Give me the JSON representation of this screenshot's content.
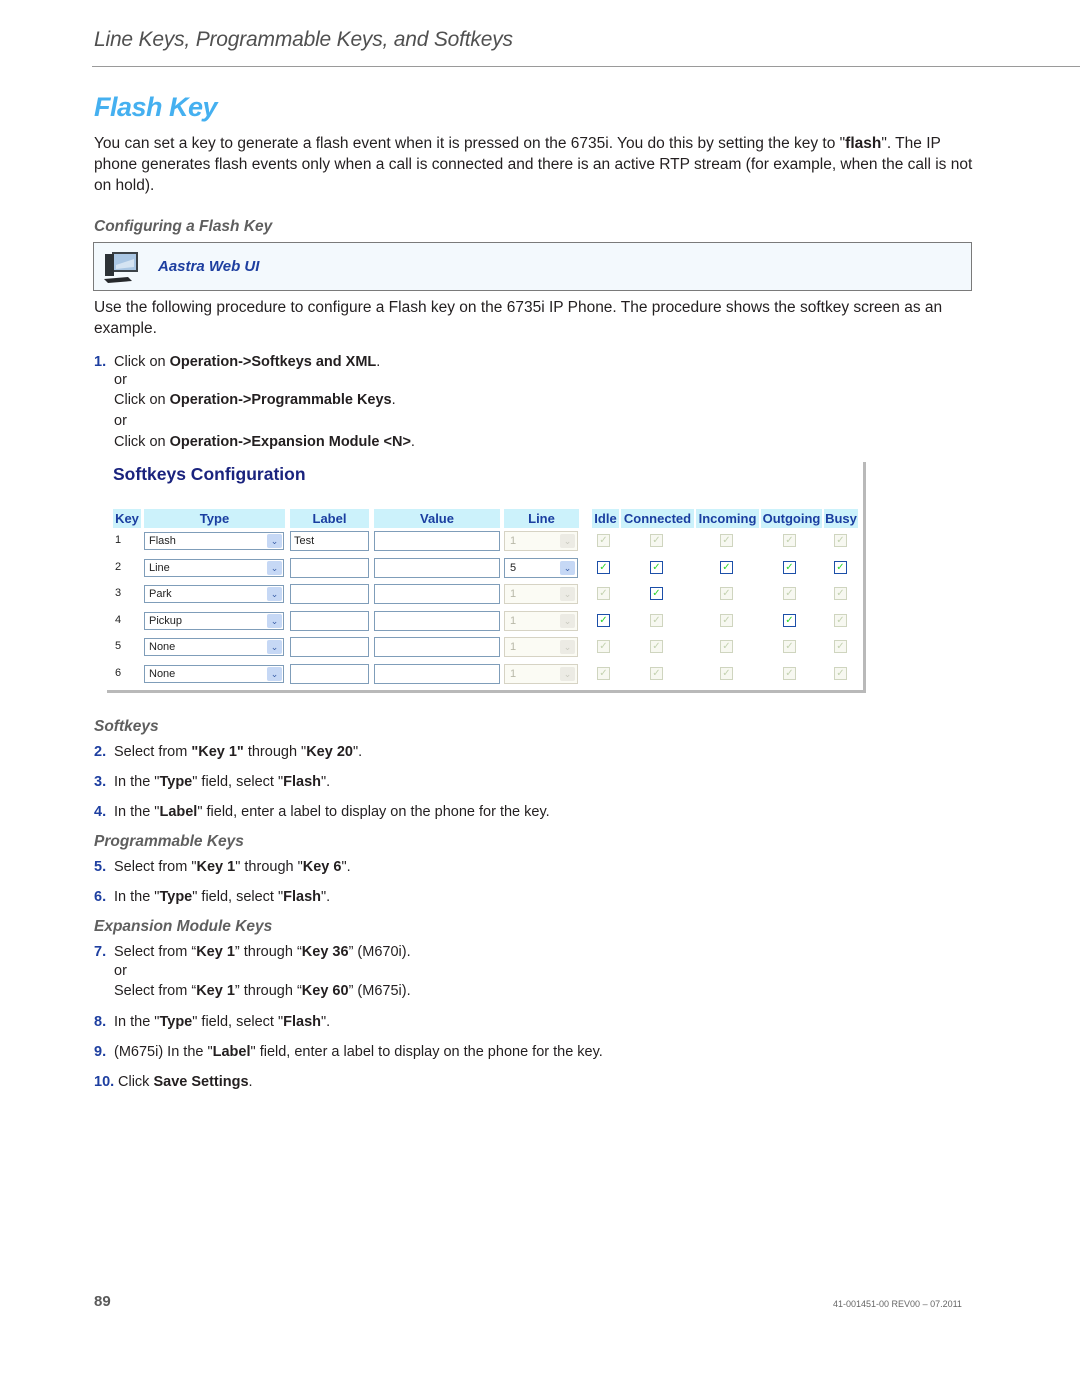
{
  "running_head": "Line Keys, Programmable Keys, and Softkeys",
  "title": "Flash Key",
  "intro": {
    "before": "You can set a key to generate a flash event when it is pressed on the 6735i. You do this by setting the key to \"",
    "bold": "flash",
    "after": "\". The IP phone generates flash events only when a call is connected and there is an active RTP stream (for example, when the call is not on hold)."
  },
  "section_heading": "Configuring a Flash Key",
  "web_ui_box": {
    "icon": "computer-icon",
    "label": "Aastra Web UI"
  },
  "procedure_intro": "Use the following procedure to configure a Flash key on the 6735i IP Phone. The procedure shows the softkey screen as an example.",
  "step1": {
    "num": "1.",
    "a_pre": "Click on ",
    "a_bold": "Operation->Softkeys and XML",
    "a_post": ".",
    "or1": "or",
    "b_pre": "Click on ",
    "b_bold": "Operation->Programmable Keys",
    "b_post": ".",
    "or2": "or",
    "c_pre": "Click on ",
    "c_bold": "Operation->Expansion Module <N>",
    "c_post": "."
  },
  "screenshot": {
    "title": "Softkeys Configuration",
    "columns": [
      "Key",
      "Type",
      "Label",
      "Value",
      "Line",
      "Idle",
      "Connected",
      "Incoming",
      "Outgoing",
      "Busy"
    ],
    "rows": [
      {
        "key": "1",
        "type": "Flash",
        "label": "Test",
        "value": "",
        "line": "1",
        "line_enabled": false,
        "states": [
          {
            "checked": true,
            "enabled": false
          },
          {
            "checked": true,
            "enabled": false
          },
          {
            "checked": true,
            "enabled": false
          },
          {
            "checked": true,
            "enabled": false
          },
          {
            "checked": true,
            "enabled": false
          }
        ]
      },
      {
        "key": "2",
        "type": "Line",
        "label": "",
        "value": "",
        "line": "5",
        "line_enabled": true,
        "states": [
          {
            "checked": true,
            "enabled": true
          },
          {
            "checked": true,
            "enabled": true
          },
          {
            "checked": true,
            "enabled": true
          },
          {
            "checked": true,
            "enabled": true
          },
          {
            "checked": true,
            "enabled": true
          }
        ]
      },
      {
        "key": "3",
        "type": "Park",
        "label": "",
        "value": "",
        "line": "1",
        "line_enabled": false,
        "states": [
          {
            "checked": true,
            "enabled": false
          },
          {
            "checked": true,
            "enabled": true
          },
          {
            "checked": true,
            "enabled": false
          },
          {
            "checked": true,
            "enabled": false
          },
          {
            "checked": true,
            "enabled": false
          }
        ]
      },
      {
        "key": "4",
        "type": "Pickup",
        "label": "",
        "value": "",
        "line": "1",
        "line_enabled": false,
        "states": [
          {
            "checked": true,
            "enabled": true
          },
          {
            "checked": true,
            "enabled": false
          },
          {
            "checked": true,
            "enabled": false
          },
          {
            "checked": true,
            "enabled": true
          },
          {
            "checked": true,
            "enabled": false
          }
        ]
      },
      {
        "key": "5",
        "type": "None",
        "label": "",
        "value": "",
        "line": "1",
        "line_enabled": false,
        "states": [
          {
            "checked": true,
            "enabled": false
          },
          {
            "checked": true,
            "enabled": false
          },
          {
            "checked": true,
            "enabled": false
          },
          {
            "checked": true,
            "enabled": false
          },
          {
            "checked": true,
            "enabled": false
          }
        ]
      },
      {
        "key": "6",
        "type": "None",
        "label": "",
        "value": "",
        "line": "1",
        "line_enabled": false,
        "states": [
          {
            "checked": true,
            "enabled": false
          },
          {
            "checked": true,
            "enabled": false
          },
          {
            "checked": true,
            "enabled": false
          },
          {
            "checked": true,
            "enabled": false
          },
          {
            "checked": true,
            "enabled": false
          }
        ]
      }
    ]
  },
  "softkeys_heading": "Softkeys",
  "step2": {
    "num": "2.",
    "p1": "Select from ",
    "b1": "\"Key 1\"",
    "p2": " through \"",
    "b2": "Key 20",
    "p3": "\"."
  },
  "step3": {
    "num": "3.",
    "p1": "In the \"",
    "b1": "Type",
    "p2": "\" field, select \"",
    "b2": "Flash",
    "p3": "\"."
  },
  "step4": {
    "num": "4.",
    "p1": "In the \"",
    "b1": "Label",
    "p2": "\" field, enter a label to display on the phone for the key."
  },
  "programmable_heading": "Programmable Keys",
  "step5": {
    "num": "5.",
    "p1": "Select from \"",
    "b1": "Key 1",
    "p2": "\" through \"",
    "b2": "Key 6",
    "p3": "\"."
  },
  "step6": {
    "num": "6.",
    "p1": "In the \"",
    "b1": "Type",
    "p2": "\" field, select \"",
    "b2": "Flash",
    "p3": "\"."
  },
  "expansion_heading": "Expansion Module Keys",
  "step7": {
    "num": "7.",
    "p1": "Select from “",
    "b1": "Key 1",
    "p2": "” through “",
    "b2": "Key 36",
    "p3": "” (M670i).",
    "or": "or",
    "q1": "Select from “",
    "c1": "Key 1",
    "q2": "” through “",
    "c2": "Key 60",
    "q3": "” (M675i)."
  },
  "step8": {
    "num": "8.",
    "p1": "In the \"",
    "b1": "Type",
    "p2": "\" field, select \"",
    "b2": "Flash",
    "p3": "\"."
  },
  "step9": {
    "num": "9.",
    "p1": "(M675i) In the \"",
    "b1": "Label",
    "p2": "\" field, enter a label to display on the phone for the key."
  },
  "step10": {
    "num": "10.",
    "p1": "Click ",
    "b1": "Save Settings",
    "p2": "."
  },
  "footer": {
    "page_number": "89",
    "doc_id": "41-001451-00 REV00 – 07.2011"
  }
}
